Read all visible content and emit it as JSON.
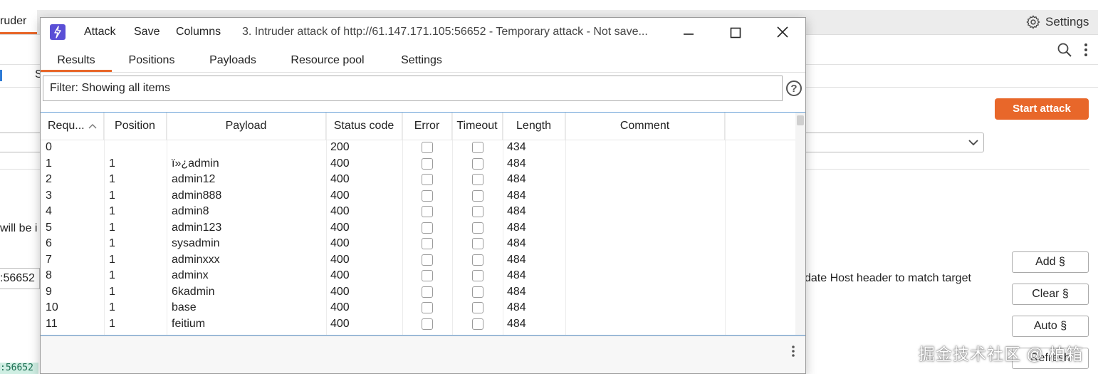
{
  "background": {
    "active_tab": "ruder",
    "settings_label": "Settings",
    "start_attack_label": "Start attack",
    "tab_fragment": "S",
    "side_text": "will be i",
    "host_fragment": ":56652",
    "update_host_label": "date Host header to match target",
    "add_label": "Add §",
    "clear_label": "Clear §",
    "auto_label": "Auto §",
    "refresh_label": "Refresh",
    "highlight_text": ":56652",
    "accent": "#e8672a"
  },
  "watermark": "掘金技术社区 @ 柏箱",
  "window": {
    "menu": [
      "Attack",
      "Save",
      "Columns"
    ],
    "title": "3. Intruder attack of http://61.147.171.105:56652 - Temporary attack - Not save...",
    "tabs": [
      "Results",
      "Positions",
      "Payloads",
      "Resource pool",
      "Settings"
    ],
    "active_tab": "Results",
    "filter_text": "Filter: Showing all items",
    "help_icon": "?"
  },
  "table": {
    "columns": [
      "Requ...",
      "Position",
      "Payload",
      "Status code",
      "Error",
      "Timeout",
      "Length",
      "Comment"
    ],
    "sort_column": "Requ...",
    "rows": [
      {
        "req": "0",
        "pos": "",
        "payload": "",
        "status": "200",
        "length": "434"
      },
      {
        "req": "1",
        "pos": "1",
        "payload": "ï»¿admin",
        "status": "400",
        "length": "484"
      },
      {
        "req": "2",
        "pos": "1",
        "payload": "admin12",
        "status": "400",
        "length": "484"
      },
      {
        "req": "3",
        "pos": "1",
        "payload": "admin888",
        "status": "400",
        "length": "484"
      },
      {
        "req": "4",
        "pos": "1",
        "payload": "admin8",
        "status": "400",
        "length": "484"
      },
      {
        "req": "5",
        "pos": "1",
        "payload": "admin123",
        "status": "400",
        "length": "484"
      },
      {
        "req": "6",
        "pos": "1",
        "payload": "sysadmin",
        "status": "400",
        "length": "484"
      },
      {
        "req": "7",
        "pos": "1",
        "payload": "adminxxx",
        "status": "400",
        "length": "484"
      },
      {
        "req": "8",
        "pos": "1",
        "payload": "adminx",
        "status": "400",
        "length": "484"
      },
      {
        "req": "9",
        "pos": "1",
        "payload": "6kadmin",
        "status": "400",
        "length": "484"
      },
      {
        "req": "10",
        "pos": "1",
        "payload": "base",
        "status": "400",
        "length": "484"
      },
      {
        "req": "11",
        "pos": "1",
        "payload": "feitium",
        "status": "400",
        "length": "484"
      }
    ]
  }
}
